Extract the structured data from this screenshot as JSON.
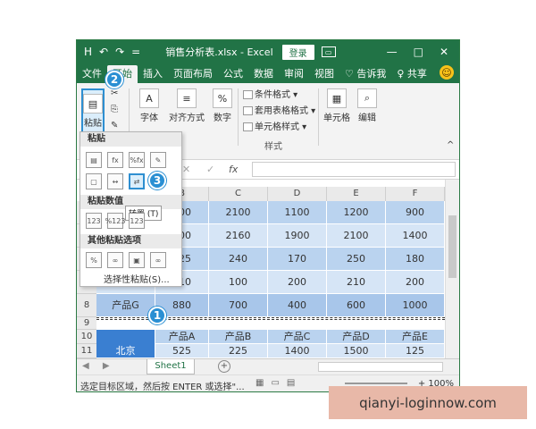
{
  "titlebar": {
    "filename": "销售分析表.xlsx - Excel",
    "login": "登录",
    "save_icon": "H",
    "undo_icon": "↶",
    "redo_icon": "↷",
    "qa_more": "=",
    "opt_icon": "▭",
    "min": "—",
    "restore": "□",
    "close": "✕"
  },
  "tabs": [
    "文件",
    "开始",
    "插入",
    "页面布局",
    "公式",
    "数据",
    "审阅",
    "视图",
    "♡ 告诉我",
    "♀ 共享"
  ],
  "tabs_smile": "☺",
  "ribbon": {
    "paste_label": "粘贴",
    "font_label": "字体",
    "align_label": "对齐方式",
    "number_label": "数字",
    "number_icon": "%",
    "cond_format": "条件格式 ▾",
    "table_format": "套用表格格式 ▾",
    "cell_style": "单元格样式 ▾",
    "styles_group": "样式",
    "cells_label": "单元格",
    "edit_label": "编辑",
    "font_icon": "A",
    "align_icon": "≡",
    "cells_icon": "▦",
    "edit_icon": "⌕"
  },
  "badges": {
    "b1": "1",
    "b2": "2",
    "b3": "3"
  },
  "formula_bar": {
    "cancel": "✕",
    "confirm": "✓",
    "fx": "fx"
  },
  "columns": [
    "B",
    "C",
    "D",
    "E",
    "F"
  ],
  "rows_visible": [
    {
      "num": "",
      "label": "",
      "values": [
        "400",
        "2100",
        "1100",
        "1200",
        "900"
      ]
    },
    {
      "num": "",
      "label": "",
      "values": [
        "500",
        "2160",
        "1900",
        "2100",
        "1400"
      ]
    },
    {
      "num": "",
      "label": "",
      "values": [
        "125",
        "240",
        "170",
        "250",
        "180"
      ]
    },
    {
      "num": "",
      "label": "",
      "values": [
        "110",
        "100",
        "200",
        "210",
        "200"
      ]
    },
    {
      "num": "8",
      "label": "产品G",
      "values": [
        "880",
        "700",
        "400",
        "600",
        "1000"
      ]
    }
  ],
  "row9": "9",
  "row10": {
    "num": "10",
    "values": [
      "产品A",
      "产品B",
      "产品C",
      "产品D",
      "产品E"
    ]
  },
  "row11": {
    "num": "11",
    "label": "北京",
    "values": [
      "525",
      "225",
      "1400",
      "1500",
      "125"
    ]
  },
  "paste_menu": {
    "paste_header": "粘贴",
    "values_header": "粘贴数值",
    "other_header": "其他粘贴选项",
    "tooltip": "转置 (T)",
    "special": "选择性粘贴(S)...",
    "icons_row1": [
      "▤",
      "fx",
      "%fx",
      "✎"
    ],
    "icons_row2": [
      "▢",
      "↔",
      "⇄"
    ],
    "icons_values": [
      "123",
      "%123",
      "123"
    ],
    "icons_other": [
      "%",
      "∞",
      "▣",
      "∞"
    ]
  },
  "sheet_bar": {
    "nav": "◀ ▶",
    "sheet": "Sheet1",
    "add": "+"
  },
  "status": {
    "message": "选定目标区域，然后按 ENTER 或选择\"...",
    "zoom": "+ 100%",
    "views": [
      "▦",
      "▭",
      "▤"
    ]
  },
  "watermark": "qianyi-loginnow.com"
}
